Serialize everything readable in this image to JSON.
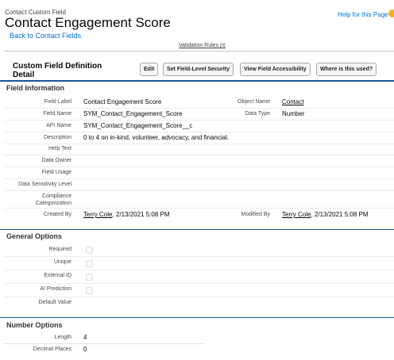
{
  "header": {
    "eyebrow": "Contact Custom Field",
    "title": "Contact Engagement Score",
    "help_link": "Help for this Page",
    "back_link": "Back to Contact Fields",
    "validation_rules": "Validation Rules",
    "validation_count": "[0]"
  },
  "detail": {
    "title": "Custom Field Definition Detail",
    "buttons": {
      "edit": "Edit",
      "set_fls": "Set Field-Level Security",
      "view_access": "View Field Accessibility",
      "where_used": "Where is this used?"
    }
  },
  "field_info": {
    "heading": "Field Information",
    "field_label": {
      "label": "Field Label",
      "value": "Contact Engagement Score"
    },
    "object_name": {
      "label": "Object Name",
      "value": "Contact"
    },
    "field_name": {
      "label": "Field Name",
      "value": "SYM_Contact_Engagement_Score"
    },
    "data_type": {
      "label": "Data Type",
      "value": "Number"
    },
    "api_name": {
      "label": "API Name",
      "value": "SYM_Contact_Engagement_Score__c"
    },
    "description": {
      "label": "Description",
      "value": "0 to 4 on in-kind, volunteer, advocacy, and financial."
    },
    "help_text": {
      "label": "Help Text",
      "value": ""
    },
    "data_owner": {
      "label": "Data Owner",
      "value": ""
    },
    "field_usage": {
      "label": "Field Usage",
      "value": ""
    },
    "sensitivity": {
      "label": "Data Sensitivity Level",
      "value": ""
    },
    "compliance": {
      "label": "Compliance Categorization",
      "value": ""
    },
    "created_by": {
      "label": "Created By",
      "user": "Terry Cole",
      "date": ", 2/13/2021 5:08 PM"
    },
    "modified_by": {
      "label": "Modified By",
      "user": "Terry Cole",
      "date": ", 2/13/2021 5:08 PM"
    }
  },
  "general_options": {
    "heading": "General Options",
    "required": {
      "label": "Required",
      "checked": false
    },
    "unique": {
      "label": "Unique",
      "checked": false
    },
    "external_id": {
      "label": "External ID",
      "checked": false
    },
    "ai_prediction": {
      "label": "AI Prediction",
      "checked": false
    },
    "default_value": {
      "label": "Default Value",
      "value": ""
    }
  },
  "number_options": {
    "heading": "Number Options",
    "length": {
      "label": "Length",
      "value": "4"
    },
    "decimal_places": {
      "label": "Decimal Places",
      "value": "0"
    }
  },
  "colors": {
    "link": "#0070d2",
    "section_rule": "#1b5297",
    "help_icon": "#f2b31b"
  },
  "icons": {
    "help": "help-icon"
  }
}
